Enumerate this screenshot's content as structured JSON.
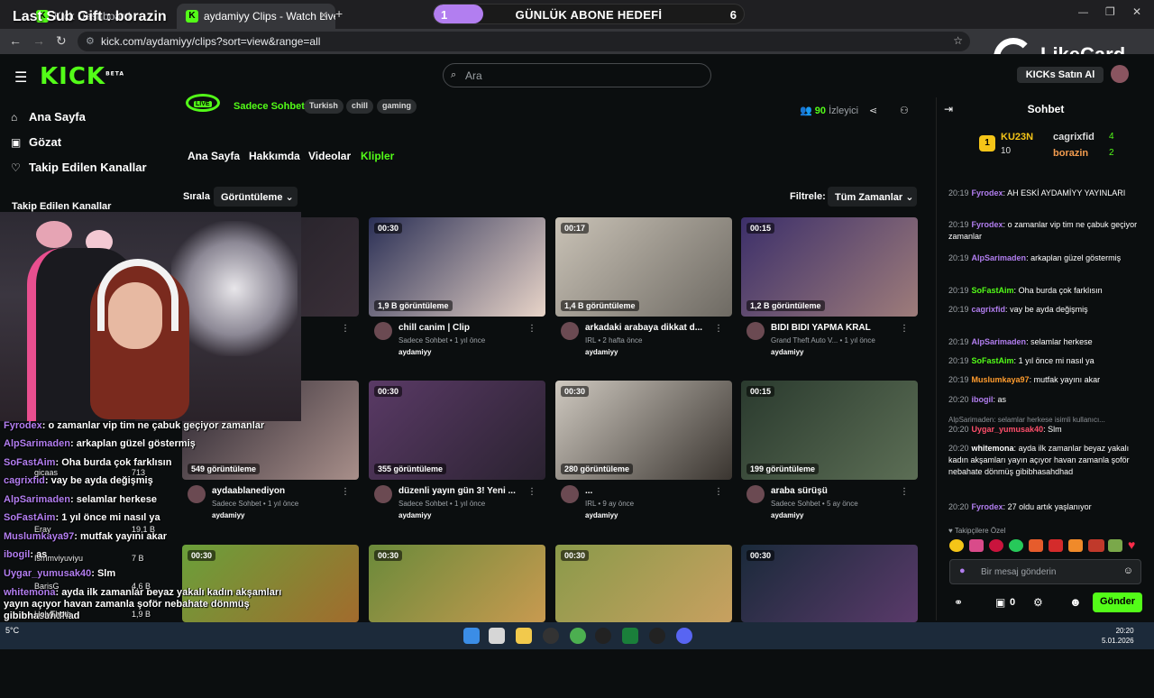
{
  "browser": {
    "tabs": [
      {
        "label": "Kick Dashboard"
      },
      {
        "label": "aydamiyy Clips - Watch Live on Ki",
        "active": true
      }
    ],
    "url": "kick.com/aydamiyy/clips?sort=view&range=all"
  },
  "overlay": {
    "last_sub": "Last Sub Gift : borazin",
    "goal_title": "GÜNLÜK ABONE HEDEFİ",
    "goal_start": "1",
    "goal_end": "6",
    "goal_progress": 0.16,
    "likecard": "LikeCard"
  },
  "header": {
    "logo": "KICK",
    "logo_badge": "BETA",
    "search_placeholder": "Ara",
    "kicks_button": "KICKs Satın Al"
  },
  "sidebar": {
    "items": [
      {
        "icon": "home-icon",
        "label": "Ana Sayfa"
      },
      {
        "icon": "compass-icon",
        "label": "Gözat"
      },
      {
        "icon": "heart-icon",
        "label": "Takip Edilen Kanallar"
      }
    ],
    "followed_heading": "Takip Edilen Kanallar"
  },
  "channel": {
    "live_label": "LIVE",
    "category": "Sadece Sohbet",
    "tags": [
      "Turkish",
      "chill",
      "gaming"
    ],
    "viewers_count": "90",
    "viewers_label": "İzleyici",
    "tabs": [
      "Ana Sayfa",
      "Hakkımda",
      "Videolar",
      "Klipler"
    ],
    "active_tab": "Klipler"
  },
  "filters": {
    "sort_label": "Sırala",
    "sort_value": "Görüntüleme",
    "filter_label": "Filtrele:",
    "filter_value": "Tüm Zamanlar"
  },
  "clips": [
    {
      "duration": "",
      "views": "",
      "title": "",
      "meta": "ce",
      "author": ""
    },
    {
      "duration": "00:30",
      "views": "1,9 B görüntüleme",
      "title": "chill canim | Clip",
      "meta": "Sadece Sohbet • 1 yıl önce",
      "author": "aydamiyy"
    },
    {
      "duration": "00:17",
      "views": "1,4 B görüntüleme",
      "title": "arkadaki arabaya dikkat d...",
      "meta": "IRL • 2 hafta önce",
      "author": "aydamiyy"
    },
    {
      "duration": "00:15",
      "views": "1,2 B görüntüleme",
      "title": "BIDI BIDI YAPMA KRAL",
      "meta": "Grand Theft Auto V... • 1 yıl önce",
      "author": "aydamiyy"
    },
    {
      "duration": "",
      "views": "549 görüntüleme",
      "title": "aydaablanediyon",
      "meta": "Sadece Sohbet • 1 yıl önce",
      "author": "aydamiyy"
    },
    {
      "duration": "00:30",
      "views": "355 görüntüleme",
      "title": "düzenli yayın gün 3! Yeni ...",
      "meta": "Sadece Sohbet • 1 yıl önce",
      "author": "aydamiyy"
    },
    {
      "duration": "00:30",
      "views": "280 görüntüleme",
      "title": "...",
      "meta": "IRL • 9 ay önce",
      "author": "aydamiyy"
    },
    {
      "duration": "00:15",
      "views": "199 görüntüleme",
      "title": "araba sürüşü",
      "meta": "Sadece Sohbet • 5 ay önce",
      "author": "aydamiyy"
    },
    {
      "duration": "00:30",
      "views": "",
      "title": "",
      "meta": "",
      "author": ""
    },
    {
      "duration": "00:30",
      "views": "",
      "title": "",
      "meta": "",
      "author": ""
    },
    {
      "duration": "00:30",
      "views": "",
      "title": "",
      "meta": "",
      "author": ""
    },
    {
      "duration": "00:30",
      "views": "",
      "title": "",
      "meta": "",
      "author": ""
    }
  ],
  "chat": {
    "title": "Sohbet",
    "leaderboard": {
      "top_name": "KU23N",
      "top_count": "10",
      "second_name": "cagrixfid",
      "second_count": "4",
      "third_name": "borazin",
      "third_count": "2"
    },
    "messages": [
      {
        "time": "20:19",
        "user": "Fyrodex",
        "color": "#b27ef0",
        "text": "AH ESKİ AYDAMİYY YAYINLARI"
      },
      {
        "time": "20:19",
        "user": "Fyrodex",
        "color": "#b27ef0",
        "text": "o zamanlar vip tim ne çabuk geçiyor zamanlar"
      },
      {
        "time": "20:19",
        "user": "AlpSarimaden",
        "color": "#b27ef0",
        "text": "arkaplan güzel göstermiş"
      },
      {
        "time": "20:19",
        "user": "SoFastAim",
        "color": "#53fc18",
        "text": "Oha burda çok farklısın"
      },
      {
        "time": "20:19",
        "user": "cagrixfid",
        "color": "#b27ef0",
        "text": "vay be ayda değişmiş"
      },
      {
        "time": "20:19",
        "user": "AlpSarimaden",
        "color": "#b27ef0",
        "text": "selamlar herkese"
      },
      {
        "time": "20:19",
        "user": "SoFastAim",
        "color": "#53fc18",
        "text": "1 yıl önce mi nasıl ya"
      },
      {
        "time": "20:19",
        "user": "Muslumkaya97",
        "color": "#ff9c2e",
        "text": "mutfak yayını akar"
      },
      {
        "time": "20:20",
        "user": "ibogil",
        "color": "#b27ef0",
        "text": "as"
      },
      {
        "time": "20:20",
        "user": "Uygar_yumusak40",
        "color": "#ff4f6b",
        "text": "Slm"
      },
      {
        "time": "20:20",
        "user": "whitemona",
        "color": "#ffffff",
        "text": "ayda ilk zamanlar beyaz yakalı kadın akşamları yayın açıyor havan zamanla şoför nebahate dönmüş gibibhasahdhad"
      },
      {
        "time": "20:20",
        "user": "Fyrodex",
        "color": "#b27ef0",
        "text": "27 oldu artık yaşlanıyor"
      }
    ],
    "reply_preview": "AlpSarimaden: selamlar herkese isimli kullanıcı...",
    "emote_heading": "Takipçilere Özel",
    "input_placeholder": "Bir mesaj gönderin",
    "kicks_count": "0",
    "send_label": "Gönder"
  },
  "webcam_chat": [
    {
      "user": "Fyrodex",
      "text": "o zamanlar vip tim ne çabuk geçiyor zamanlar"
    },
    {
      "user": "AlpSarimaden",
      "text": "arkaplan güzel göstermiş"
    },
    {
      "user": "SoFastAim",
      "text": "Oha burda çok farklısın"
    },
    {
      "user": "cagrixfid",
      "text": "vay be ayda değişmiş"
    },
    {
      "user": "AlpSarimaden",
      "text": "selamlar herkese"
    },
    {
      "user": "SoFastAim",
      "text": "1 yıl önce mi nasıl ya"
    },
    {
      "user": "Muslumkaya97",
      "text": "mutfak yayını akar"
    },
    {
      "user": "ibogil",
      "text": "as"
    },
    {
      "user": "Uygar_yumusak40",
      "text": "Slm"
    },
    {
      "user": "whitemona",
      "text": "ayda ilk zamanlar beyaz yakalı kadın akşamları yayın açıyor havan zamanla şoför nebahate dönmüş gibibhasahdhad"
    },
    {
      "user": "Fyrodex",
      "text": "27 oldu artık yaşlanıyor"
    }
  ],
  "followed_overlay": [
    {
      "name": "gicaas",
      "count": "713"
    },
    {
      "name": "Eray",
      "count": "19,1 B"
    },
    {
      "name": "Ismmviyuviyu",
      "count": "7 B"
    },
    {
      "name": "BarisG",
      "count": "4,6 B"
    },
    {
      "name": "HolyThoth",
      "count": "1,9 B"
    }
  ],
  "taskbar": {
    "time": "20:20",
    "date": "5.01.2026",
    "weather": "5°C"
  }
}
